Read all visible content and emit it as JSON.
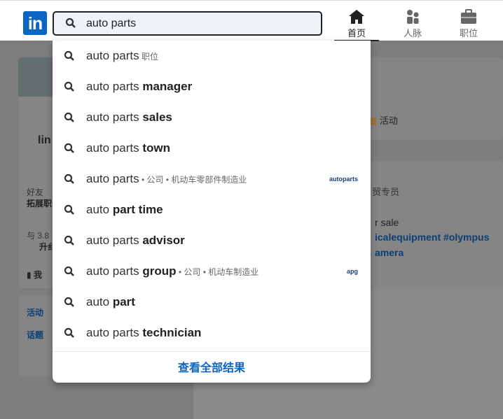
{
  "header": {
    "logo": "in",
    "search": {
      "value": "auto parts"
    },
    "nav": [
      {
        "label": "首页",
        "icon": "home-icon",
        "active": true
      },
      {
        "label": "人脉",
        "icon": "people-icon"
      },
      {
        "label": "职位",
        "icon": "briefcase-icon"
      }
    ]
  },
  "background": {
    "left_card": {
      "name": "lin",
      "stat_label": "好友",
      "stat_sub": "拓展职",
      "invite": "与 3.8",
      "upgrade": "升纟",
      "saved": "我"
    },
    "left_card2": {
      "link1": "活动",
      "link2": "话题"
    },
    "right": {
      "activity": "活动",
      "title_frag": "贸专员",
      "sale": "r sale",
      "tags1": "icalequipment #olympus",
      "tags2": "amera"
    }
  },
  "dropdown": {
    "items": [
      {
        "plain": "auto parts",
        "bold": "",
        "meta": " 职位"
      },
      {
        "plain": "auto parts ",
        "bold": "manager",
        "meta": ""
      },
      {
        "plain": "auto parts ",
        "bold": "sales",
        "meta": ""
      },
      {
        "plain": "auto parts ",
        "bold": "town",
        "meta": ""
      },
      {
        "plain": "auto parts",
        "bold": "",
        "meta": " • 公司 • 机动车零部件制造业",
        "logo": "autoparts"
      },
      {
        "plain": "auto ",
        "bold": "part time",
        "meta": ""
      },
      {
        "plain": "auto parts ",
        "bold": "advisor",
        "meta": ""
      },
      {
        "plain": "auto parts ",
        "bold": "group",
        "meta": " • 公司 • 机动车制造业",
        "logo": "apg"
      },
      {
        "plain": "auto ",
        "bold": "part",
        "meta": ""
      },
      {
        "plain": "auto parts ",
        "bold": "technician",
        "meta": ""
      }
    ],
    "see_all": "查看全部结果"
  },
  "colors": {
    "brand": "#0a66c2"
  }
}
